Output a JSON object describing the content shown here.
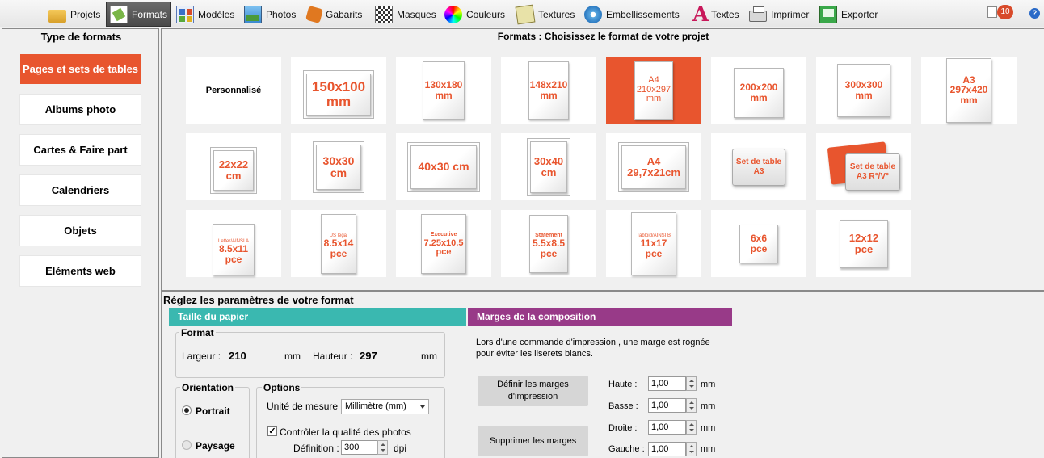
{
  "toolbar": {
    "items": [
      {
        "label": "Projets",
        "icon": "folder-icon"
      },
      {
        "label": "Formats",
        "icon": "formats-icon",
        "active": true
      },
      {
        "label": "Modèles",
        "icon": "models-icon"
      },
      {
        "label": "Photos",
        "icon": "photos-icon"
      },
      {
        "label": "Gabarits",
        "icon": "puzzle-icon"
      },
      {
        "label": "Masques",
        "icon": "checker-icon"
      },
      {
        "label": "Couleurs",
        "icon": "color-wheel-icon"
      },
      {
        "label": "Textures",
        "icon": "texture-icon"
      },
      {
        "label": "Embellissements",
        "icon": "flower-icon"
      },
      {
        "label": "Textes",
        "icon": "text-a-icon"
      },
      {
        "label": "Imprimer",
        "icon": "printer-icon"
      },
      {
        "label": "Exporter",
        "icon": "export-icon"
      }
    ],
    "notification_count": "10",
    "help_label": "?"
  },
  "sidebar": {
    "title": "Type de formats",
    "items": [
      {
        "label": "Pages et sets de tables",
        "active": true
      },
      {
        "label": "Albums photo"
      },
      {
        "label": "Cartes & Faire part"
      },
      {
        "label": "Calendriers"
      },
      {
        "label": "Objets"
      },
      {
        "label": "Eléments web"
      }
    ]
  },
  "formats": {
    "title": "Formats : Choisissez le format de votre projet",
    "tiles": [
      {
        "label": "Personnalisé"
      },
      {
        "l1": "150x100",
        "l2": "mm"
      },
      {
        "l1": "130x180",
        "l2": "mm"
      },
      {
        "l1": "148x210",
        "l2": "mm"
      },
      {
        "l1": "A4",
        "l2": "210x297",
        "l3": "mm",
        "selected": true
      },
      {
        "l1": "200x200",
        "l2": "mm"
      },
      {
        "l1": "300x300",
        "l2": "mm"
      },
      {
        "l1": "A3",
        "l2": "297x420",
        "l3": "mm"
      },
      {
        "l1": "22x22",
        "l2": "cm"
      },
      {
        "l1": "30x30",
        "l2": "cm"
      },
      {
        "l1": "40x30 cm"
      },
      {
        "l1": "30x40",
        "l2": "cm"
      },
      {
        "l1": "A4",
        "l2": "29,7x21cm"
      },
      {
        "l1": "Set de table",
        "l2": "A3"
      },
      {
        "l1": "Set de table",
        "l2": "A3 R°/V°"
      },
      {
        "l0": "Letter/AINSI A",
        "l1": "8.5x11",
        "l2": "pce"
      },
      {
        "l0": "US legal",
        "l1": "8.5x14",
        "l2": "pce"
      },
      {
        "l0": "Executive",
        "l1": "7.25x10.5",
        "l2": "pce"
      },
      {
        "l0": "Statement",
        "l1": "5.5x8.5",
        "l2": "pce"
      },
      {
        "l0": "Tabloid/AINSI B",
        "l1": "11x17",
        "l2": "pce"
      },
      {
        "l1": "6x6",
        "l2": "pce"
      },
      {
        "l1": "12x12",
        "l2": "pce"
      }
    ]
  },
  "settings": {
    "title": "Réglez les paramètres de votre format",
    "paper_header": "Taille du papier",
    "margins_header": "Marges de la composition",
    "format_group": "Format",
    "width_label": "Largeur :",
    "width_value": "210",
    "width_unit": "mm",
    "height_label": "Hauteur :",
    "height_value": "297",
    "height_unit": "mm",
    "orientation_group": "Orientation",
    "portrait_label": "Portrait",
    "landscape_label": "Paysage",
    "options_group": "Options",
    "unit_label": "Unité de mesure :",
    "unit_value": "Millimètre (mm)",
    "quality_label": "Contrôler la qualité des photos",
    "quality_checked": true,
    "definition_label": "Définition :",
    "definition_value": "300",
    "definition_unit": "dpi",
    "margins_note": "Lors d'une commande d'impression , une marge est rognée pour éviter les liserets blancs.",
    "define_margins_button": "Définir les marges d'impression",
    "remove_margins_button": "Supprimer les marges",
    "margins": [
      {
        "label": "Haute :",
        "value": "1,00",
        "unit": "mm"
      },
      {
        "label": "Basse :",
        "value": "1,00",
        "unit": "mm"
      },
      {
        "label": "Droite :",
        "value": "1,00",
        "unit": "mm"
      },
      {
        "label": "Gauche :",
        "value": "1,00",
        "unit": "mm"
      }
    ]
  },
  "colors": {
    "accent": "#e8552e",
    "teal": "#3ab8b0",
    "purple": "#983a88"
  }
}
